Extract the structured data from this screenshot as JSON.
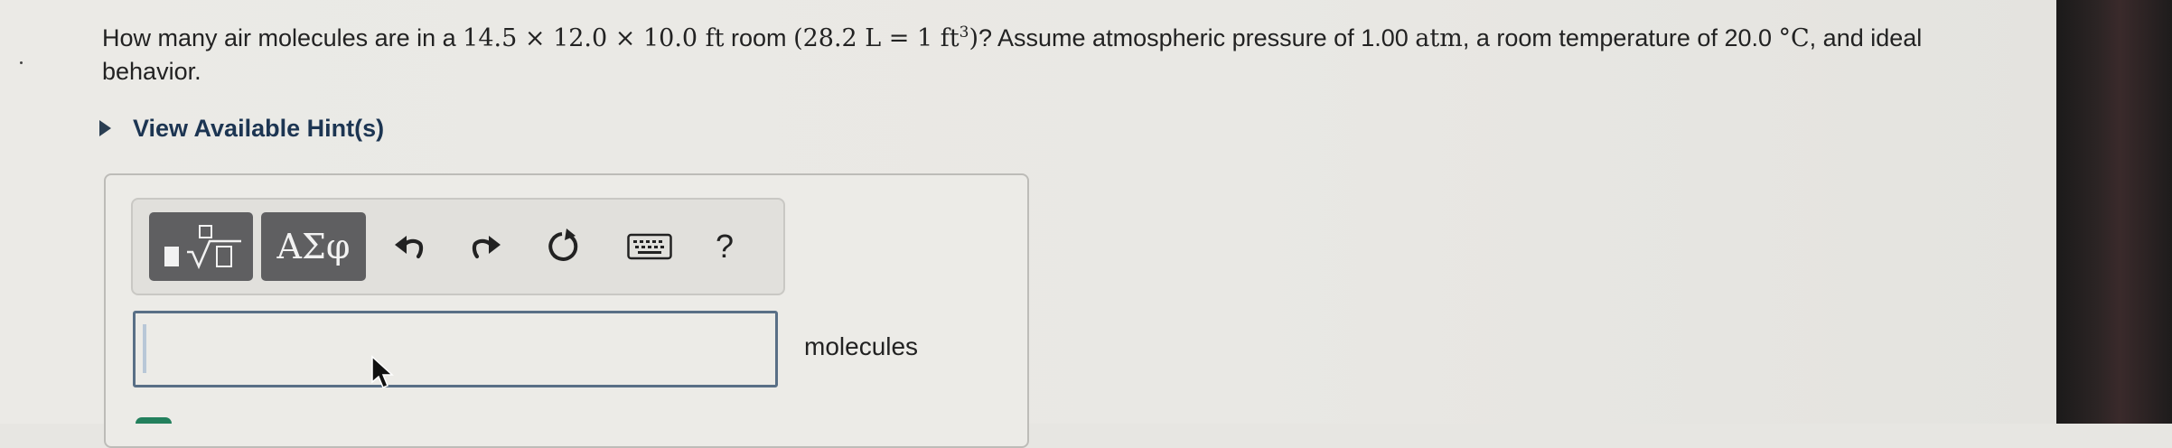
{
  "question": {
    "prefix": "How many air molecules are in a ",
    "room_dims": "14.5 × 12.0 × 10.0 ft",
    "room_word": " room ",
    "conversion_open": "(28.2 L = 1 ft",
    "conversion_exp": "3",
    "conversion_close": ")",
    "text_middle": "? Assume atmospheric pressure of 1.00 ",
    "pressure_unit": "atm",
    "text_after_pressure": ", a room temperature of 20.0 ",
    "temp_unit": "°C",
    "text_end": ", and ideal behavior."
  },
  "hint": {
    "label": "View Available Hint(s)"
  },
  "toolbar": {
    "templates_icon": "square-root-template-icon",
    "greek_label": "ΑΣφ",
    "undo_icon": "undo-icon",
    "redo_icon": "redo-icon",
    "reset_icon": "reset-icon",
    "keyboard_icon": "keyboard-icon",
    "help_label": "?"
  },
  "answer": {
    "value": "",
    "unit": "molecules"
  },
  "colors": {
    "accent_link": "#1c3552",
    "input_border": "#596f86",
    "toolbar_button": "#5f5f61"
  }
}
